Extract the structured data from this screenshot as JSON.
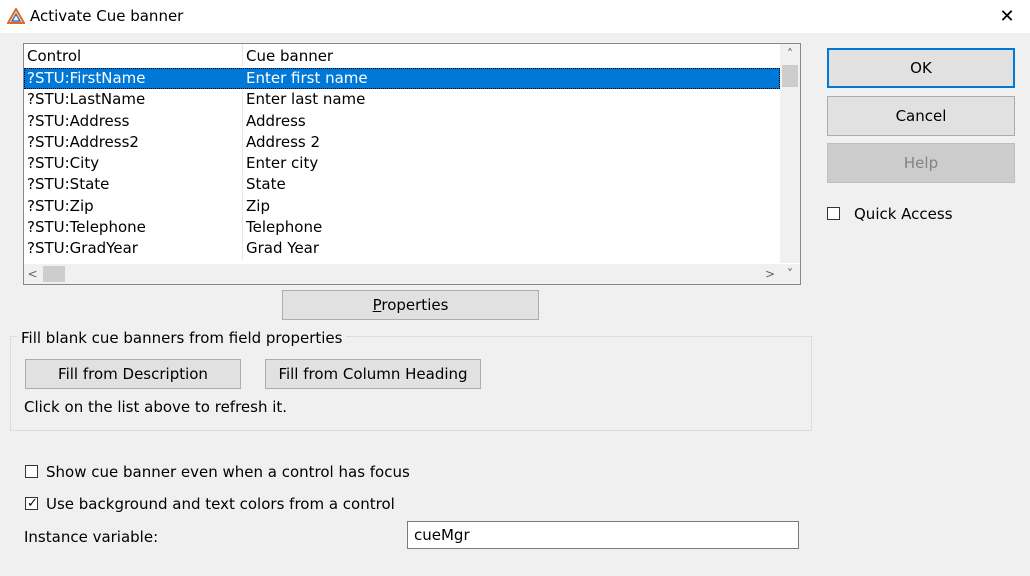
{
  "window": {
    "title": "Activate Cue banner",
    "close_glyph": "✕",
    "icon": "triangle-app-icon"
  },
  "list": {
    "columns": [
      "Control",
      "Cue banner"
    ],
    "rows": [
      {
        "control": "?STU:FirstName",
        "cue": "Enter first name",
        "selected": true
      },
      {
        "control": "?STU:LastName",
        "cue": "Enter last name"
      },
      {
        "control": "?STU:Address",
        "cue": "Address"
      },
      {
        "control": "?STU:Address2",
        "cue": "Address 2"
      },
      {
        "control": "?STU:City",
        "cue": "Enter city"
      },
      {
        "control": "?STU:State",
        "cue": "State"
      },
      {
        "control": "?STU:Zip",
        "cue": "Zip"
      },
      {
        "control": "?STU:Telephone",
        "cue": "Telephone"
      },
      {
        "control": "?STU:GradYear",
        "cue": "Grad Year"
      }
    ],
    "scroll_up_glyph": "˄",
    "scroll_down_glyph": "˅",
    "scroll_left_glyph": "<",
    "scroll_right_glyph": ">"
  },
  "buttons": {
    "ok": "OK",
    "cancel": "Cancel",
    "help": "Help",
    "properties_prefix": "",
    "properties_accel": "P",
    "properties_rest": "roperties",
    "fill_description": "Fill from Description",
    "fill_heading": "Fill from Column Heading"
  },
  "quick_access": {
    "label": "Quick Access",
    "checked": false
  },
  "group": {
    "label": "Fill blank cue banners from field properties",
    "hint": "Click on the list above to refresh it."
  },
  "options": {
    "show_focus": {
      "label": "Show cue banner even when a control has focus",
      "checked": false
    },
    "use_colors": {
      "label": "Use background and text colors from a control",
      "checked": true
    }
  },
  "instance": {
    "label": "Instance variable:",
    "value": "cueMgr"
  },
  "colors": {
    "selection": "#0078d7",
    "dialog_bg": "#f0f0f0",
    "default_border": "#0078d7"
  }
}
